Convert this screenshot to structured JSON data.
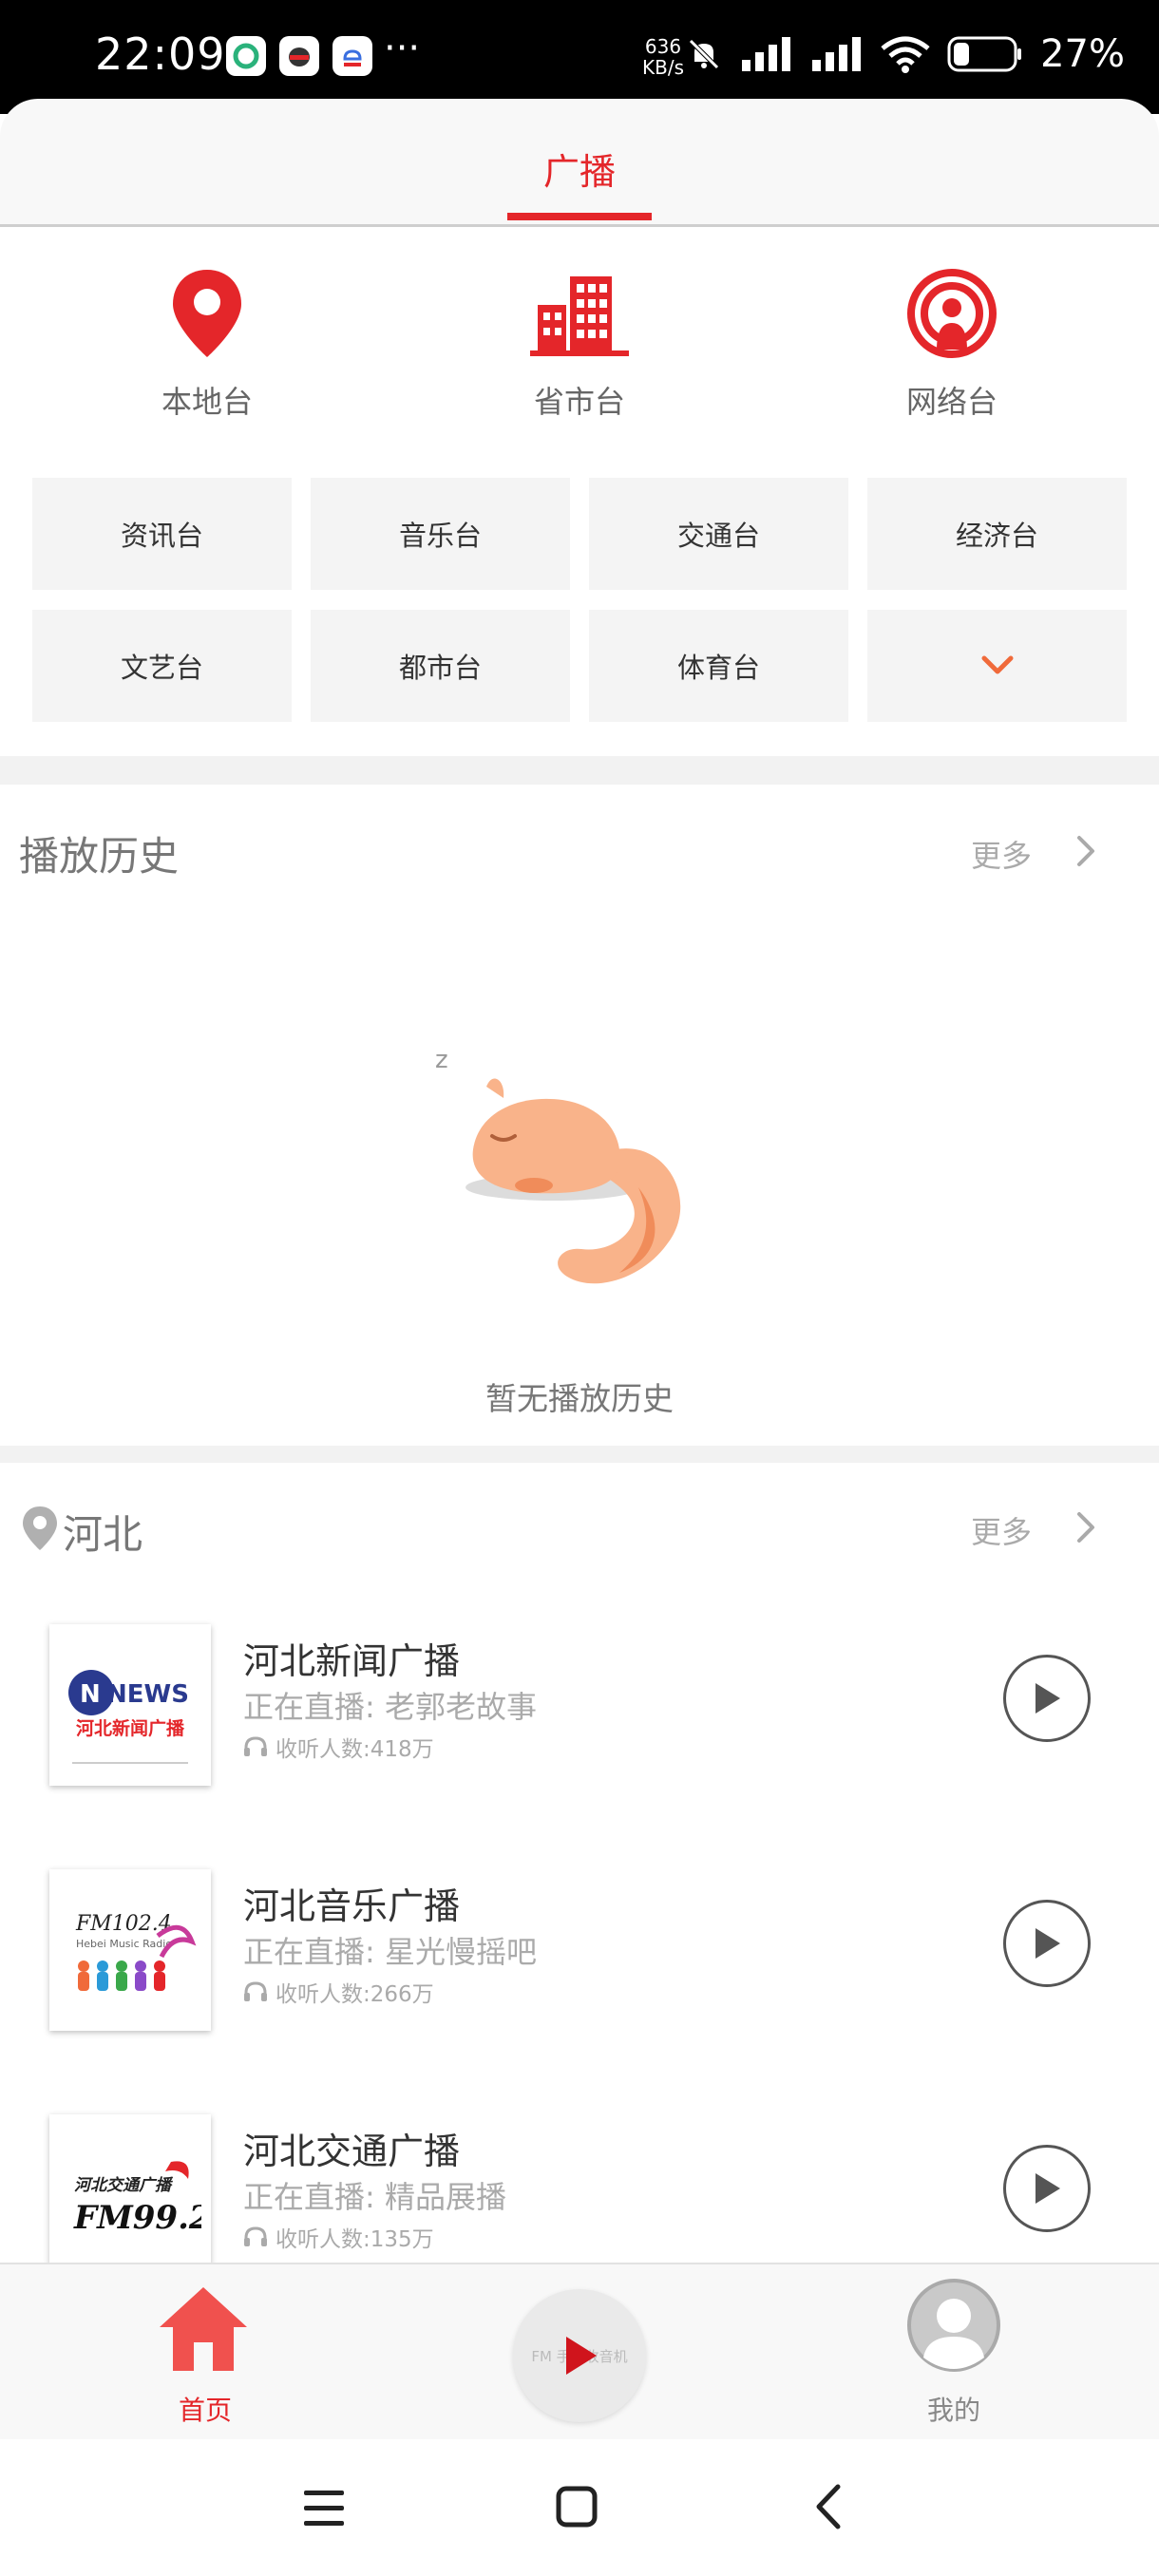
{
  "status_bar": {
    "time": "22:09",
    "app_icons": [
      "wechat-chat-icon",
      "qq-icon",
      "cloud-app-icon"
    ],
    "more": "···",
    "net_speed_value": "636",
    "net_speed_unit": "KB/s",
    "battery_percent": "27%"
  },
  "tab_bar": {
    "active_tab": "广播"
  },
  "categories": [
    {
      "label": "本地台",
      "icon": "location-pin-icon"
    },
    {
      "label": "省市台",
      "icon": "buildings-icon"
    },
    {
      "label": "网络台",
      "icon": "broadcast-icon"
    }
  ],
  "genres": [
    "资讯台",
    "音乐台",
    "交通台",
    "经济台",
    "文艺台",
    "都市台",
    "体育台"
  ],
  "history": {
    "title": "播放历史",
    "more": "更多",
    "empty_text": "暂无播放历史"
  },
  "region": {
    "title": "河北",
    "more": "更多",
    "stations": [
      {
        "name": "河北新闻广播",
        "live": "正在直播: 老郭老故事",
        "listeners": "收听人数:418万",
        "logo_text_top": "NEWS",
        "logo_text_bottom": "河北新闻广播"
      },
      {
        "name": "河北音乐广播",
        "live": "正在直播: 星光慢摇吧",
        "listeners": "收听人数:266万",
        "logo_text_top": "FM102.4",
        "logo_text_bottom": "Hebei Music Radio"
      },
      {
        "name": "河北交通广播",
        "live": "正在直播: 精品展播",
        "listeners": "收听人数:135万",
        "logo_text_top": "河北交通广播",
        "logo_text_bottom": "FM99.2"
      }
    ]
  },
  "bottom_nav": {
    "home": "首页",
    "player_caption": "FM 手机收音机",
    "mine": "我的"
  },
  "colors": {
    "accent": "#e4262a",
    "orange": "#f06a3a",
    "gray_text": "#777777"
  }
}
